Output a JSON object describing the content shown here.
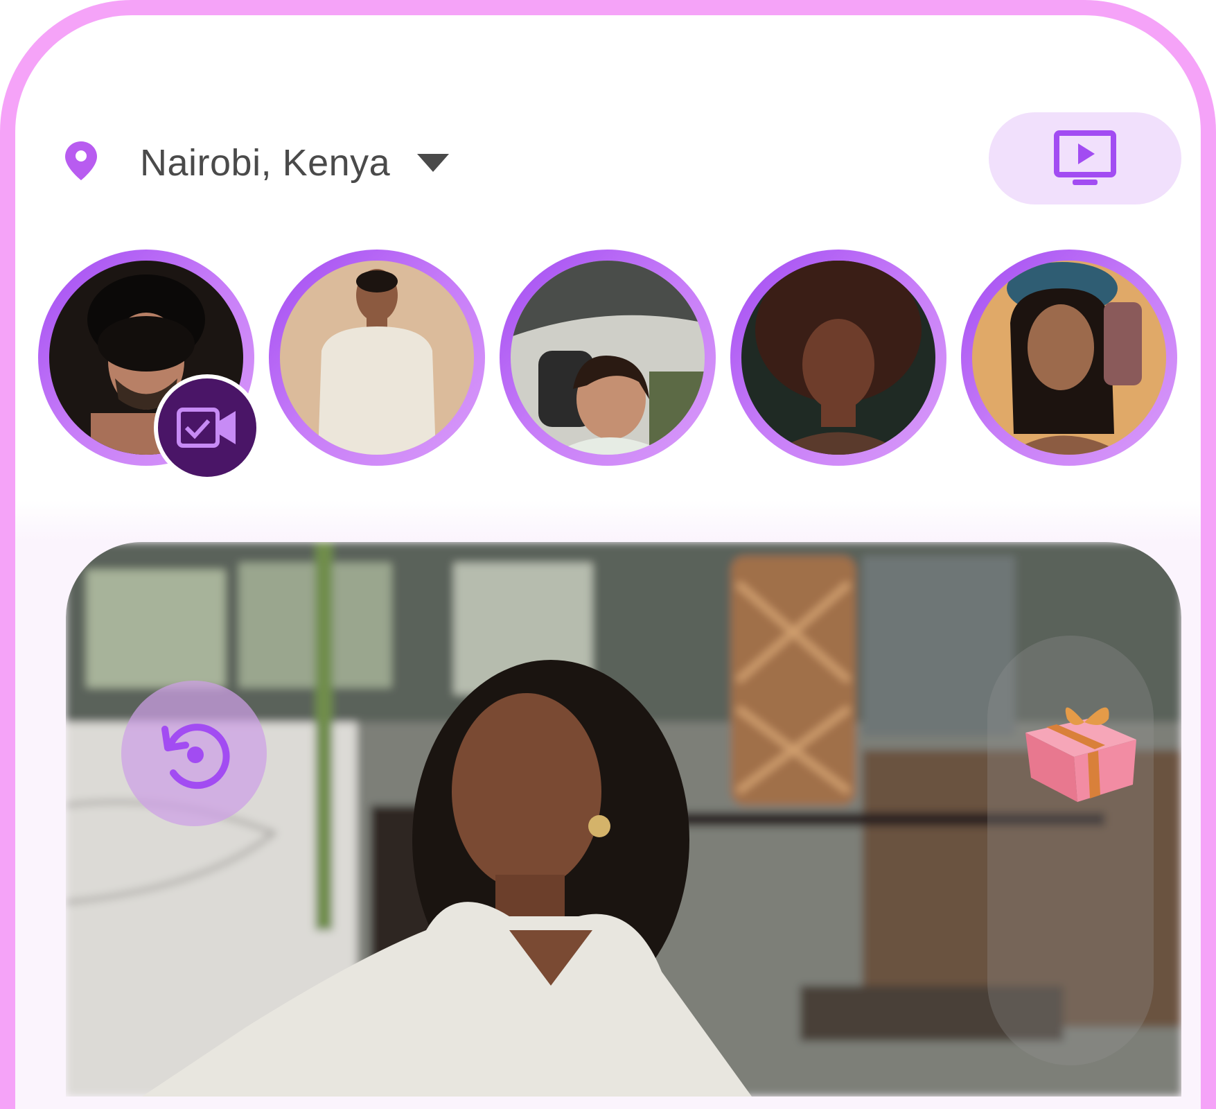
{
  "header": {
    "location_icon": "location-pin-icon",
    "location_label": "Nairobi, Kenya",
    "dropdown_icon": "caret-down-icon",
    "live_button_icon": "tv-play-icon"
  },
  "stories": [
    {
      "id": 1,
      "live": true,
      "badge_icon": "video-check-icon"
    },
    {
      "id": 2,
      "live": false
    },
    {
      "id": 3,
      "live": false
    },
    {
      "id": 4,
      "live": false
    },
    {
      "id": 5,
      "live": false
    }
  ],
  "card": {
    "rewind_icon": "rewind-icon",
    "gift_icon": "gift-icon"
  },
  "colors": {
    "frame": "#f5a3f8",
    "accent": "#a24cf2",
    "live_badge": "#4a1567",
    "live_button_bg": "#f1e0fc"
  }
}
